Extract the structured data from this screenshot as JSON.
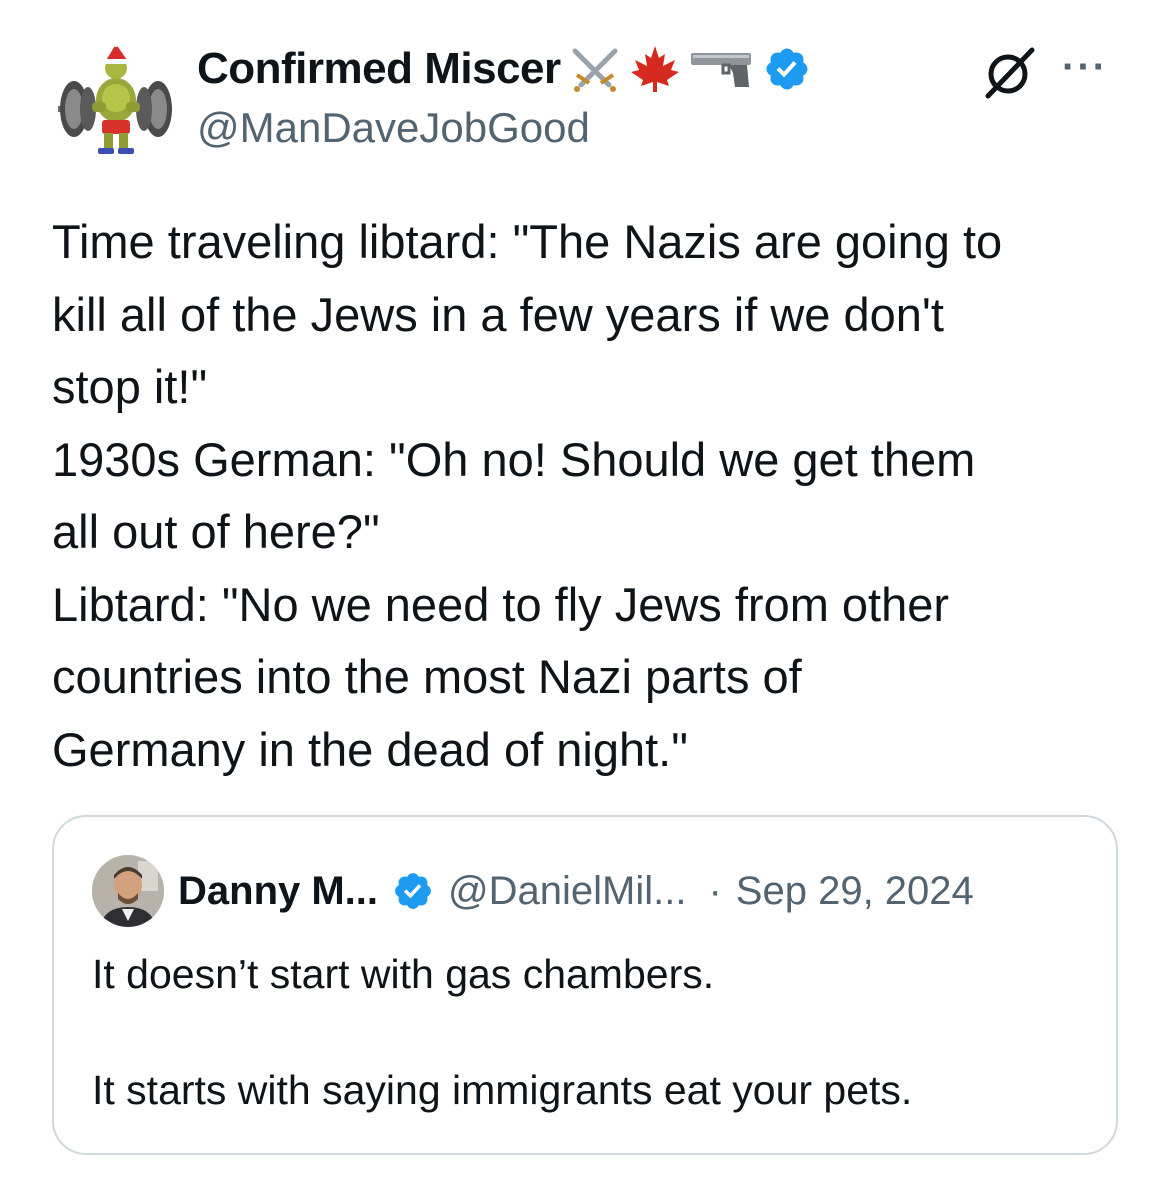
{
  "author": {
    "display_name": "Confirmed Miscer",
    "handle": "@ManDaveJobGood",
    "name_emojis": [
      "crossed-swords-icon",
      "maple-leaf-icon",
      "pistol-icon"
    ],
    "verified": true
  },
  "body_lines": [
    "Time traveling libtard: \"The Nazis are going to",
    "kill all of the Jews in a few years if we don't",
    "stop it!\"",
    "1930s German: \"Oh no! Should we get them",
    "all out of here?\"",
    "Libtard: \"No we need to fly Jews from other",
    "countries into the most Nazi parts of",
    "Germany in the dead of night.\""
  ],
  "quoted_tweet": {
    "display_name": "Danny M...",
    "handle": "@DanielMil...",
    "separator": "·",
    "date": "Sep 29, 2024",
    "verified": true,
    "text_line_1": "It doesn’t start with gas chambers.",
    "text_line_2": "It starts with saying immigrants eat your pets."
  },
  "icons": {
    "grok": "grok-icon",
    "more": "more-icon",
    "more_glyph": "···"
  },
  "colors": {
    "verified_blue": "#1d9bf0",
    "secondary_text": "#536471",
    "border": "#cfd9de",
    "maple_red": "#d52b1e"
  }
}
